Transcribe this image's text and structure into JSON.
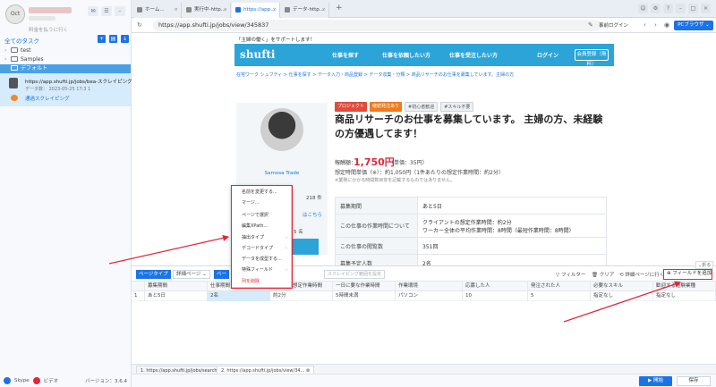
{
  "app": {
    "logo_text": "Oct",
    "plan_line": "料金を払うに行く",
    "version": "バージョン：3.6.4",
    "skype": "Skype",
    "video": "ビデオ"
  },
  "sidebar": {
    "all_tasks": "全てのタスク",
    "tree": [
      {
        "label": "test"
      },
      {
        "label": "Samples"
      },
      {
        "label": "デフォルト"
      }
    ],
    "task": {
      "url": "https://app.shufti.jp/jobs/bea-スクレイピング...",
      "data": "データ数：   2023-05-25 17:3 1",
      "link": "通過スクレイピング"
    }
  },
  "browser": {
    "tabs": [
      {
        "label": "ホーム..."
      },
      {
        "label": "実行中-http..."
      },
      {
        "label": "https://app..."
      },
      {
        "label": "データ-http..."
      }
    ],
    "url": "https://app.shufti.jp/jobs/view/345837",
    "login": "事前ログイン",
    "pc_browser": "PCブラウザ"
  },
  "site": {
    "support": "「主婦の働く」をサポートします！",
    "logo": "shufti",
    "nav": [
      "仕事を探す",
      "仕事を依頼したい方",
      "仕事を受注したい方"
    ],
    "login": "ログイン",
    "register": "会員登録（無料）",
    "breadcrumb": "在宅ワーク シュフティ > 仕事を探す > データ入力・商品登録 > データ収集・分類 > 商品リサーチのお仕事を募集しています。主婦の方",
    "profile": {
      "name": "Samosa Trade",
      "count": "218 件",
      "link": "はこちら",
      "count2": "5 名"
    },
    "tags": [
      "プロジェクト",
      "継続発注あり",
      "#初心者歓迎",
      "#スキル不要"
    ],
    "title": "商品リサーチのお仕事を募集しています。 主婦の方、未経験の方優遇してます！",
    "reward_label": "報酬額：",
    "reward_value": "1,750円",
    "reward_unit": "（単価：35円）",
    "est_line": "想定時間単価（※）：約1,050円（1件あたりの想定作業時間：約2分）",
    "note": "※業務にかかる時間数目安を記載するものではありません。",
    "info": [
      {
        "k": "募集期間",
        "v": "あと5日"
      },
      {
        "k": "この仕事の作業時間について",
        "v": "クライアントの想定作業時間：約2分",
        "v2": "ワーカー全体の平均作業時間：8時間（最短作業時間：8時間）"
      },
      {
        "k": "この仕事の閲覧数",
        "v": "351回"
      },
      {
        "k": "募集予定人数",
        "v": "2名"
      }
    ]
  },
  "context_menu": {
    "items": [
      {
        "label": "名前を変更する...",
        "sub": false,
        "danger": false
      },
      {
        "label": "マージ...",
        "sub": false,
        "danger": false
      },
      {
        "label": "ページで選択",
        "sub": false,
        "danger": false
      },
      {
        "label": "編集XPath...",
        "sub": false,
        "danger": false
      },
      {
        "label": "抽出タイプ",
        "sub": true,
        "danger": false
      },
      {
        "label": "デコードタイプ",
        "sub": true,
        "danger": false
      },
      {
        "label": "データを成型する...",
        "sub": false,
        "danger": false
      },
      {
        "label": "特殊フィールド",
        "sub": true,
        "danger": false
      },
      {
        "label": "列を削除",
        "sub": false,
        "danger": true
      }
    ]
  },
  "data_panel": {
    "page_type": "ページタイプ",
    "detail_page": "詳細ページ",
    "page_btn": "ペー",
    "crawl": "スクレイピング範囲を設定",
    "filter": "フィルター",
    "clear": "クリア",
    "goto_detail": "詳細ページに行く",
    "add_field": "フィールドを追加",
    "fold": "折る",
    "columns": [
      "",
      "募集期間",
      "仕事期間",
      "受託者の想定作業時間",
      "一日に要な作業時間",
      "作業環境",
      "応募した人",
      "発注された人",
      "必要なスキル",
      "歓迎する経験業種"
    ],
    "row": [
      "1",
      "あと5日",
      "2名",
      "約2分",
      "5時間未満",
      "パソコン",
      "10",
      "5",
      "指定なし",
      "指定なし"
    ]
  },
  "bottom": {
    "tabs": [
      "1. https://app.shufti.jp/jobs/search/...",
      "2. https://app.shufti.jp/jobs/view/34..."
    ],
    "start": "開始",
    "save": "保存"
  }
}
